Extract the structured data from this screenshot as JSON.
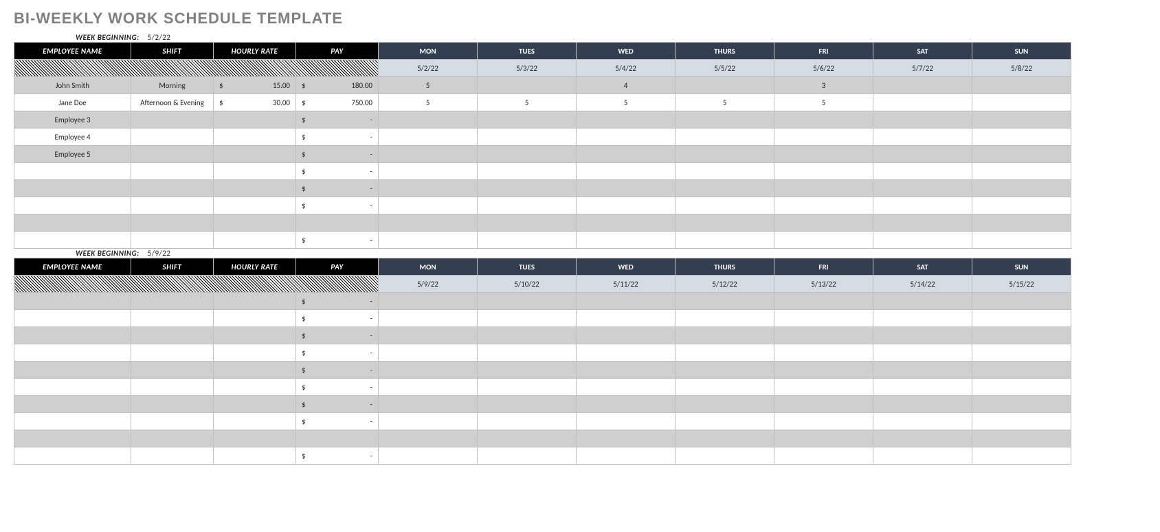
{
  "title": "BI-WEEKLY WORK SCHEDULE TEMPLATE",
  "week_beginning_label": "WEEK BEGINNING:",
  "cols": {
    "emp": "EMPLOYEE NAME",
    "shift": "SHIFT",
    "rate": "HOURLY RATE",
    "pay": "PAY",
    "days": [
      "MON",
      "TUES",
      "WED",
      "THURS",
      "FRI",
      "SAT",
      "SUN"
    ]
  },
  "weeks": [
    {
      "beginning": "5/2/22",
      "dates": [
        "5/2/22",
        "5/3/22",
        "5/4/22",
        "5/5/22",
        "5/6/22",
        "5/7/22",
        "5/8/22"
      ],
      "rows": [
        {
          "bg": "grey",
          "emp": "John Smith",
          "shift": "Morning",
          "rate": "15.00",
          "show_rate_dollar": true,
          "pay": "180.00",
          "show_pay_dollar": true,
          "days": [
            "5",
            "",
            "4",
            "",
            "3",
            "",
            ""
          ]
        },
        {
          "bg": "white",
          "emp": "Jane Doe",
          "shift": "Afternoon & Evening",
          "rate": "30.00",
          "show_rate_dollar": true,
          "pay": "750.00",
          "show_pay_dollar": true,
          "days": [
            "5",
            "5",
            "5",
            "5",
            "5",
            "",
            ""
          ]
        },
        {
          "bg": "grey",
          "emp": "Employee 3",
          "shift": "",
          "rate": "",
          "show_rate_dollar": false,
          "pay": "-",
          "show_pay_dollar": true,
          "days": [
            "",
            "",
            "",
            "",
            "",
            "",
            ""
          ]
        },
        {
          "bg": "white",
          "emp": "Employee 4",
          "shift": "",
          "rate": "",
          "show_rate_dollar": false,
          "pay": "-",
          "show_pay_dollar": true,
          "days": [
            "",
            "",
            "",
            "",
            "",
            "",
            ""
          ]
        },
        {
          "bg": "grey",
          "emp": "Employee 5",
          "shift": "",
          "rate": "",
          "show_rate_dollar": false,
          "pay": "-",
          "show_pay_dollar": true,
          "days": [
            "",
            "",
            "",
            "",
            "",
            "",
            ""
          ]
        },
        {
          "bg": "white",
          "emp": "",
          "shift": "",
          "rate": "",
          "show_rate_dollar": false,
          "pay": "-",
          "show_pay_dollar": true,
          "days": [
            "",
            "",
            "",
            "",
            "",
            "",
            ""
          ]
        },
        {
          "bg": "grey",
          "emp": "",
          "shift": "",
          "rate": "",
          "show_rate_dollar": false,
          "pay": "-",
          "show_pay_dollar": true,
          "days": [
            "",
            "",
            "",
            "",
            "",
            "",
            ""
          ]
        },
        {
          "bg": "white",
          "emp": "",
          "shift": "",
          "rate": "",
          "show_rate_dollar": false,
          "pay": "-",
          "show_pay_dollar": true,
          "days": [
            "",
            "",
            "",
            "",
            "",
            "",
            ""
          ]
        },
        {
          "bg": "grey",
          "emp": "",
          "shift": "",
          "rate": "",
          "show_rate_dollar": false,
          "pay": "",
          "show_pay_dollar": false,
          "days": [
            "",
            "",
            "",
            "",
            "",
            "",
            ""
          ]
        },
        {
          "bg": "white",
          "emp": "",
          "shift": "",
          "rate": "",
          "show_rate_dollar": false,
          "pay": "-",
          "show_pay_dollar": true,
          "days": [
            "",
            "",
            "",
            "",
            "",
            "",
            ""
          ]
        }
      ]
    },
    {
      "beginning": "5/9/22",
      "dates": [
        "5/9/22",
        "5/10/22",
        "5/11/22",
        "5/12/22",
        "5/13/22",
        "5/14/22",
        "5/15/22"
      ],
      "rows": [
        {
          "bg": "grey",
          "emp": "",
          "shift": "",
          "rate": "",
          "show_rate_dollar": false,
          "pay": "-",
          "show_pay_dollar": true,
          "days": [
            "",
            "",
            "",
            "",
            "",
            "",
            ""
          ]
        },
        {
          "bg": "white",
          "emp": "",
          "shift": "",
          "rate": "",
          "show_rate_dollar": false,
          "pay": "-",
          "show_pay_dollar": true,
          "days": [
            "",
            "",
            "",
            "",
            "",
            "",
            ""
          ]
        },
        {
          "bg": "grey",
          "emp": "",
          "shift": "",
          "rate": "",
          "show_rate_dollar": false,
          "pay": "-",
          "show_pay_dollar": true,
          "days": [
            "",
            "",
            "",
            "",
            "",
            "",
            ""
          ]
        },
        {
          "bg": "white",
          "emp": "",
          "shift": "",
          "rate": "",
          "show_rate_dollar": false,
          "pay": "-",
          "show_pay_dollar": true,
          "days": [
            "",
            "",
            "",
            "",
            "",
            "",
            ""
          ]
        },
        {
          "bg": "grey",
          "emp": "",
          "shift": "",
          "rate": "",
          "show_rate_dollar": false,
          "pay": "-",
          "show_pay_dollar": true,
          "days": [
            "",
            "",
            "",
            "",
            "",
            "",
            ""
          ]
        },
        {
          "bg": "white",
          "emp": "",
          "shift": "",
          "rate": "",
          "show_rate_dollar": false,
          "pay": "-",
          "show_pay_dollar": true,
          "days": [
            "",
            "",
            "",
            "",
            "",
            "",
            ""
          ]
        },
        {
          "bg": "grey",
          "emp": "",
          "shift": "",
          "rate": "",
          "show_rate_dollar": false,
          "pay": "-",
          "show_pay_dollar": true,
          "days": [
            "",
            "",
            "",
            "",
            "",
            "",
            ""
          ]
        },
        {
          "bg": "white",
          "emp": "",
          "shift": "",
          "rate": "",
          "show_rate_dollar": false,
          "pay": "-",
          "show_pay_dollar": true,
          "days": [
            "",
            "",
            "",
            "",
            "",
            "",
            ""
          ]
        },
        {
          "bg": "grey",
          "emp": "",
          "shift": "",
          "rate": "",
          "show_rate_dollar": false,
          "pay": "",
          "show_pay_dollar": false,
          "days": [
            "",
            "",
            "",
            "",
            "",
            "",
            ""
          ]
        },
        {
          "bg": "white",
          "emp": "",
          "shift": "",
          "rate": "",
          "show_rate_dollar": false,
          "pay": "-",
          "show_pay_dollar": true,
          "days": [
            "",
            "",
            "",
            "",
            "",
            "",
            ""
          ]
        }
      ]
    }
  ]
}
